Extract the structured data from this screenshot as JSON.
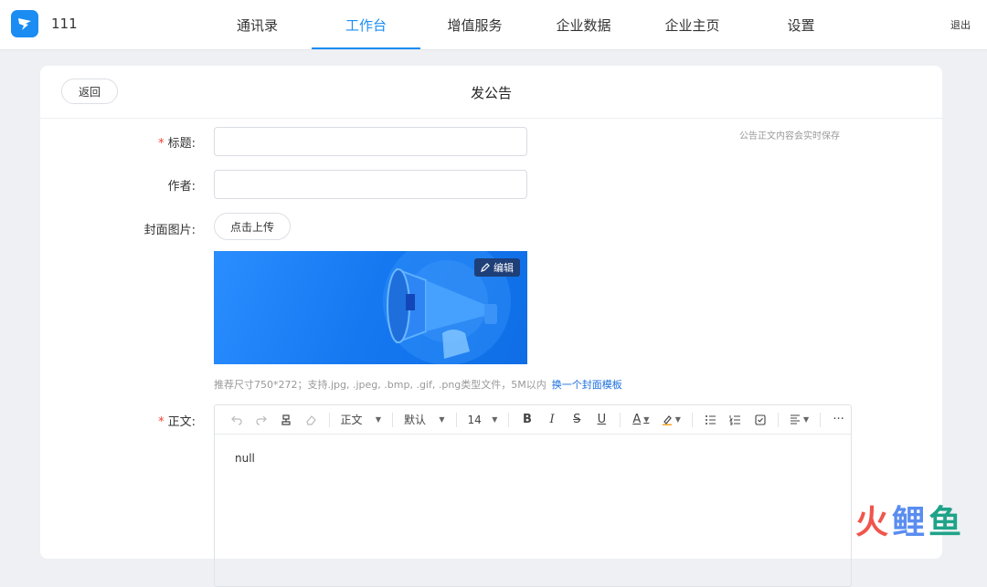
{
  "header": {
    "org_name": "111",
    "tabs": [
      {
        "label": "通讯录"
      },
      {
        "label": "工作台",
        "active": true
      },
      {
        "label": "增值服务"
      },
      {
        "label": "企业数据"
      },
      {
        "label": "企业主页"
      },
      {
        "label": "设置"
      }
    ],
    "logout_label": "退出"
  },
  "page": {
    "back_label": "返回",
    "title": "发公告",
    "autosave_note": "公告正文内容会实时保存"
  },
  "form": {
    "title_label": "标题:",
    "title_value": "",
    "author_label": "作者:",
    "author_value": "",
    "cover_label": "封面图片:",
    "upload_label": "点击上传",
    "cover_edit_label": "编辑",
    "cover_hint": "推荐尺寸750*272；支持.jpg, .jpeg, .bmp, .gif, .png类型文件，5M以内",
    "cover_template_link": "换一个封面模板",
    "body_label": "正文:",
    "body_content": "null"
  },
  "toolbar": {
    "paragraph_style": "正文",
    "font_family": "默认",
    "font_size": "14",
    "bold": "B",
    "italic": "I",
    "strikethrough": "S",
    "underline": "U",
    "font_color": "A",
    "more": "···"
  },
  "watermark": [
    "火",
    "鲤",
    "鱼"
  ],
  "colors": {
    "accent": "#1b8cf2",
    "required": "#f04134",
    "link": "#1b6fe0",
    "cover_blue": "#1578f0"
  }
}
